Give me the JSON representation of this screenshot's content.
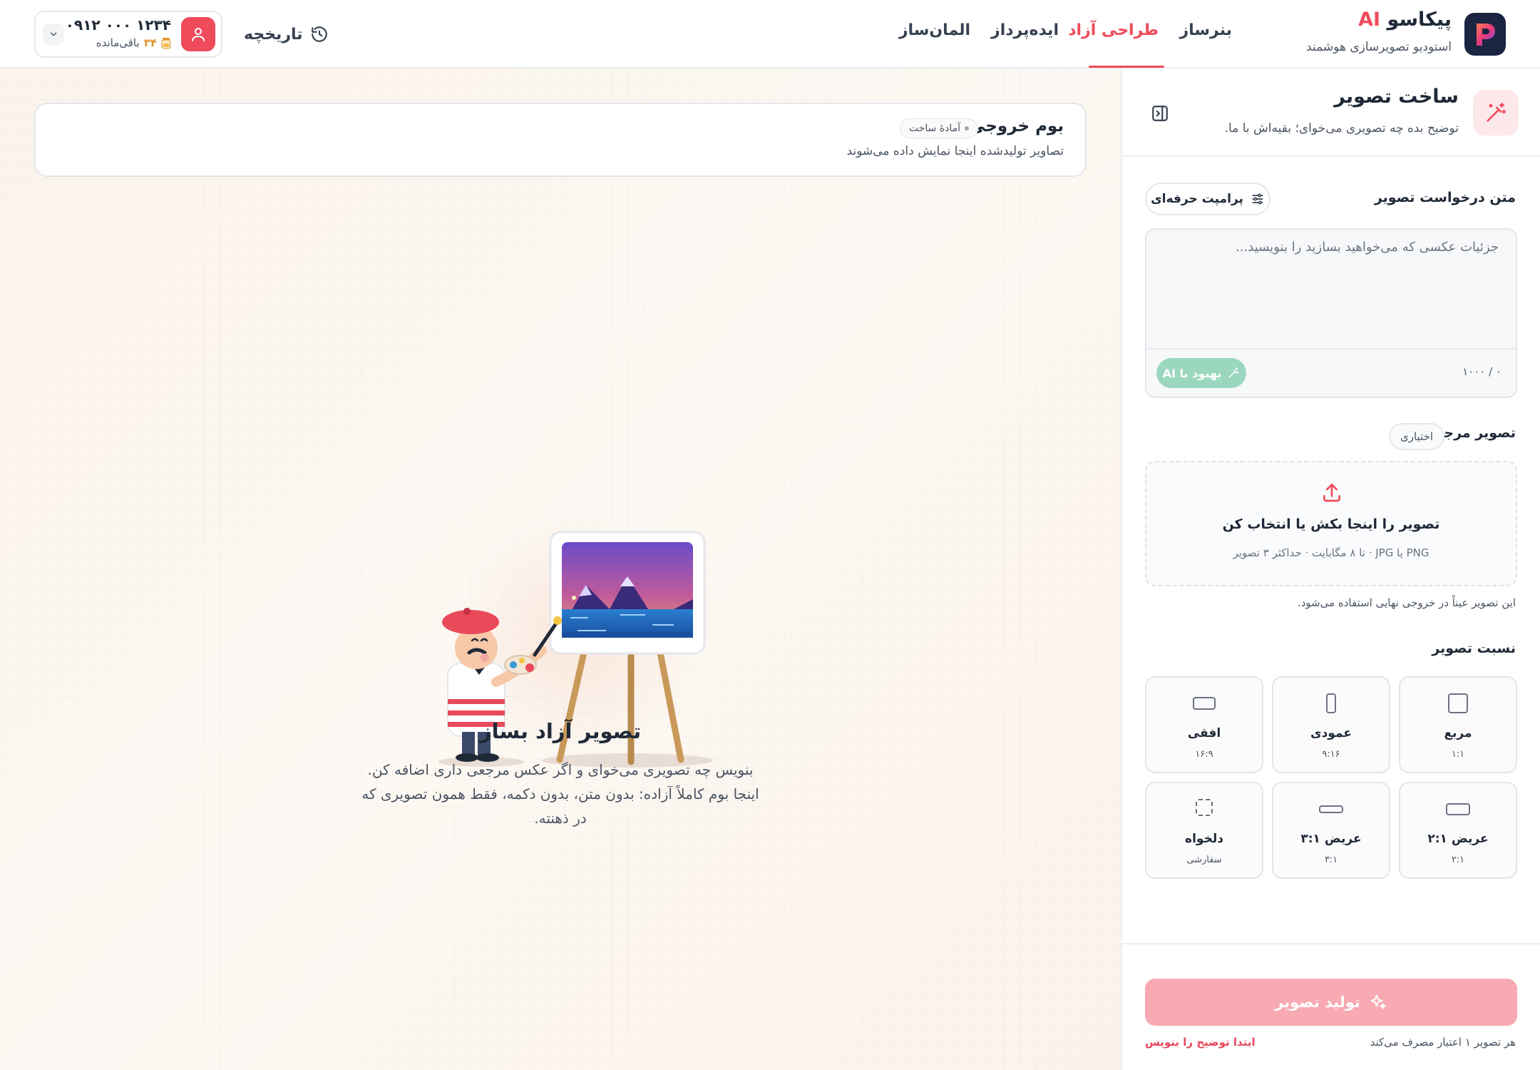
{
  "brand": {
    "name": "پیکاسو",
    "ai": "AI",
    "subtitle": "استودیو تصویرسازی هوشمند"
  },
  "nav": {
    "items": [
      {
        "label": "بنرساز",
        "active": false
      },
      {
        "label": "طراحی آزاد",
        "active": true
      },
      {
        "label": "ایده‌پرداز",
        "active": false
      },
      {
        "label": "المان‌ساز",
        "active": false
      }
    ]
  },
  "history": {
    "label": "تاریخچه"
  },
  "account": {
    "phone": "۰۹۱۲ ۰۰۰ ۱۲۳۴",
    "credit_value": "۳۴",
    "credit_label": "باقی‌مانده"
  },
  "canvas": {
    "title": "بوم خروجی",
    "badge": "آمادهٔ ساخت",
    "subtitle": "تصاویر تولیدشده اینجا نمایش داده می‌شوند"
  },
  "empty_state": {
    "title": "تصویر آزاد بساز",
    "description": "بنویس چه تصویری می‌خوای و اگر عکس مرجعی داری اضافه کن. اینجا بوم کاملاً آزاده: بدون متن، بدون دکمه، فقط همون تصویری که در ذهنته."
  },
  "sidebar": {
    "title": "ساخت تصویر",
    "subtitle": "توضیح بده چه تصویری می‌خوای؛ بقیه‌اش با ما.",
    "prompt": {
      "label": "متن درخواست تصویر",
      "pro_button": "پرامپت حرفه‌ای",
      "placeholder": "جزئیات عکسی که می‌خواهید بسازید را بنویسید...",
      "value": "",
      "counter": "۰ / ۱۰۰۰",
      "enhance_button": "بهبود با AI"
    },
    "reference": {
      "label": "تصویر مرجع",
      "optional": "اختیاری",
      "upload_title": "تصویر را اینجا بکش یا انتخاب کن",
      "upload_sub": "PNG یا JPG · تا ۸ مگابایت · حداکثر ۳ تصویر",
      "note": "این تصویر عیناً در خروجی نهایی استفاده می‌شود."
    },
    "aspect": {
      "label": "نسبت تصویر",
      "options": [
        {
          "name": "مربع",
          "ratio": "۱:۱",
          "icon": "square-icon"
        },
        {
          "name": "عمودی",
          "ratio": "۹:۱۶",
          "icon": "portrait-icon"
        },
        {
          "name": "افقی",
          "ratio": "۱۶:۹",
          "icon": "landscape-icon"
        },
        {
          "name": "عریض ۲:۱",
          "ratio": "۲:۱",
          "icon": "wide-2-1-icon"
        },
        {
          "name": "عریض ۳:۱",
          "ratio": "۳:۱",
          "icon": "wide-3-1-icon"
        },
        {
          "name": "دلخواه",
          "ratio": "سفارشی",
          "icon": "custom-ratio-icon"
        }
      ]
    },
    "generate_button": "تولید تصویر",
    "cost_note": "هر تصویر ۱ اعتبار مصرف می‌کند",
    "warning": "ابتدا توضیح را بنویس"
  },
  "colors": {
    "accent": "#ef4b5b",
    "logo_bg": "#1b2440",
    "enhance": "#9bd6bf",
    "generate_disabled": "#f8a9b2"
  }
}
